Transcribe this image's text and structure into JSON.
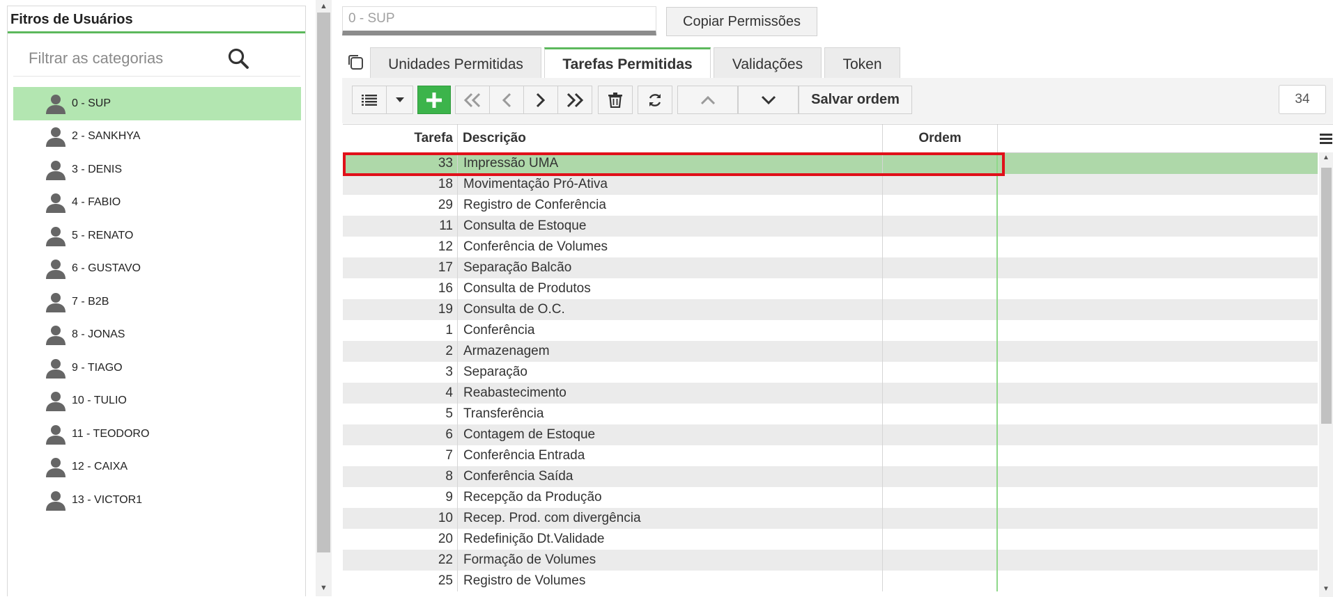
{
  "left_panel": {
    "title": "Fitros de Usuários",
    "search_placeholder": "Filtrar as categorias",
    "users": [
      {
        "label": "0 - SUP",
        "selected": true
      },
      {
        "label": "2 - SANKHYA"
      },
      {
        "label": "3 - DENIS"
      },
      {
        "label": "4 - FABIO"
      },
      {
        "label": "5 - RENATO"
      },
      {
        "label": "6 - GUSTAVO"
      },
      {
        "label": "7 - B2B"
      },
      {
        "label": "8 - JONAS"
      },
      {
        "label": "9 - TIAGO"
      },
      {
        "label": "10 - TULIO"
      },
      {
        "label": "11 - TEODORO"
      },
      {
        "label": "12 - CAIXA"
      },
      {
        "label": "13 - VICTOR1"
      }
    ]
  },
  "header": {
    "user_field": "0 - SUP",
    "copy_button": "Copiar Permissões"
  },
  "tabs": [
    {
      "label": "Unidades Permitidas"
    },
    {
      "label": "Tarefas Permitidas",
      "active": true
    },
    {
      "label": "Validações"
    },
    {
      "label": "Token"
    }
  ],
  "toolbar": {
    "save_order": "Salvar ordem",
    "record_count": "34"
  },
  "grid": {
    "columns": [
      "Tarefa",
      "Descrição",
      "Ordem"
    ],
    "rows": [
      {
        "tarefa": "33",
        "descricao": "Impressão UMA",
        "ordem": "",
        "selected": true
      },
      {
        "tarefa": "18",
        "descricao": "Movimentação Pró-Ativa",
        "ordem": ""
      },
      {
        "tarefa": "29",
        "descricao": "Registro de Conferência",
        "ordem": ""
      },
      {
        "tarefa": "11",
        "descricao": "Consulta de Estoque",
        "ordem": ""
      },
      {
        "tarefa": "12",
        "descricao": "Conferência de Volumes",
        "ordem": ""
      },
      {
        "tarefa": "17",
        "descricao": "Separação Balcão",
        "ordem": ""
      },
      {
        "tarefa": "16",
        "descricao": "Consulta de Produtos",
        "ordem": ""
      },
      {
        "tarefa": "19",
        "descricao": "Consulta de O.C.",
        "ordem": ""
      },
      {
        "tarefa": "1",
        "descricao": "Conferência",
        "ordem": ""
      },
      {
        "tarefa": "2",
        "descricao": "Armazenagem",
        "ordem": ""
      },
      {
        "tarefa": "3",
        "descricao": "Separação",
        "ordem": ""
      },
      {
        "tarefa": "4",
        "descricao": "Reabastecimento",
        "ordem": ""
      },
      {
        "tarefa": "5",
        "descricao": "Transferência",
        "ordem": ""
      },
      {
        "tarefa": "6",
        "descricao": "Contagem de Estoque",
        "ordem": ""
      },
      {
        "tarefa": "7",
        "descricao": "Conferência Entrada",
        "ordem": ""
      },
      {
        "tarefa": "8",
        "descricao": "Conferência Saída",
        "ordem": ""
      },
      {
        "tarefa": "9",
        "descricao": "Recepção da Produção",
        "ordem": ""
      },
      {
        "tarefa": "10",
        "descricao": "Recep. Prod. com divergência",
        "ordem": ""
      },
      {
        "tarefa": "20",
        "descricao": "Redefinição Dt.Validade",
        "ordem": ""
      },
      {
        "tarefa": "22",
        "descricao": "Formação de Volumes",
        "ordem": ""
      },
      {
        "tarefa": "25",
        "descricao": "Registro de Volumes",
        "ordem": ""
      }
    ]
  },
  "colors": {
    "accent_green": "#5cb85c",
    "selected_row": "#aed8a9",
    "selected_user": "#b3e6b1",
    "highlight_outline": "#e0101a"
  }
}
